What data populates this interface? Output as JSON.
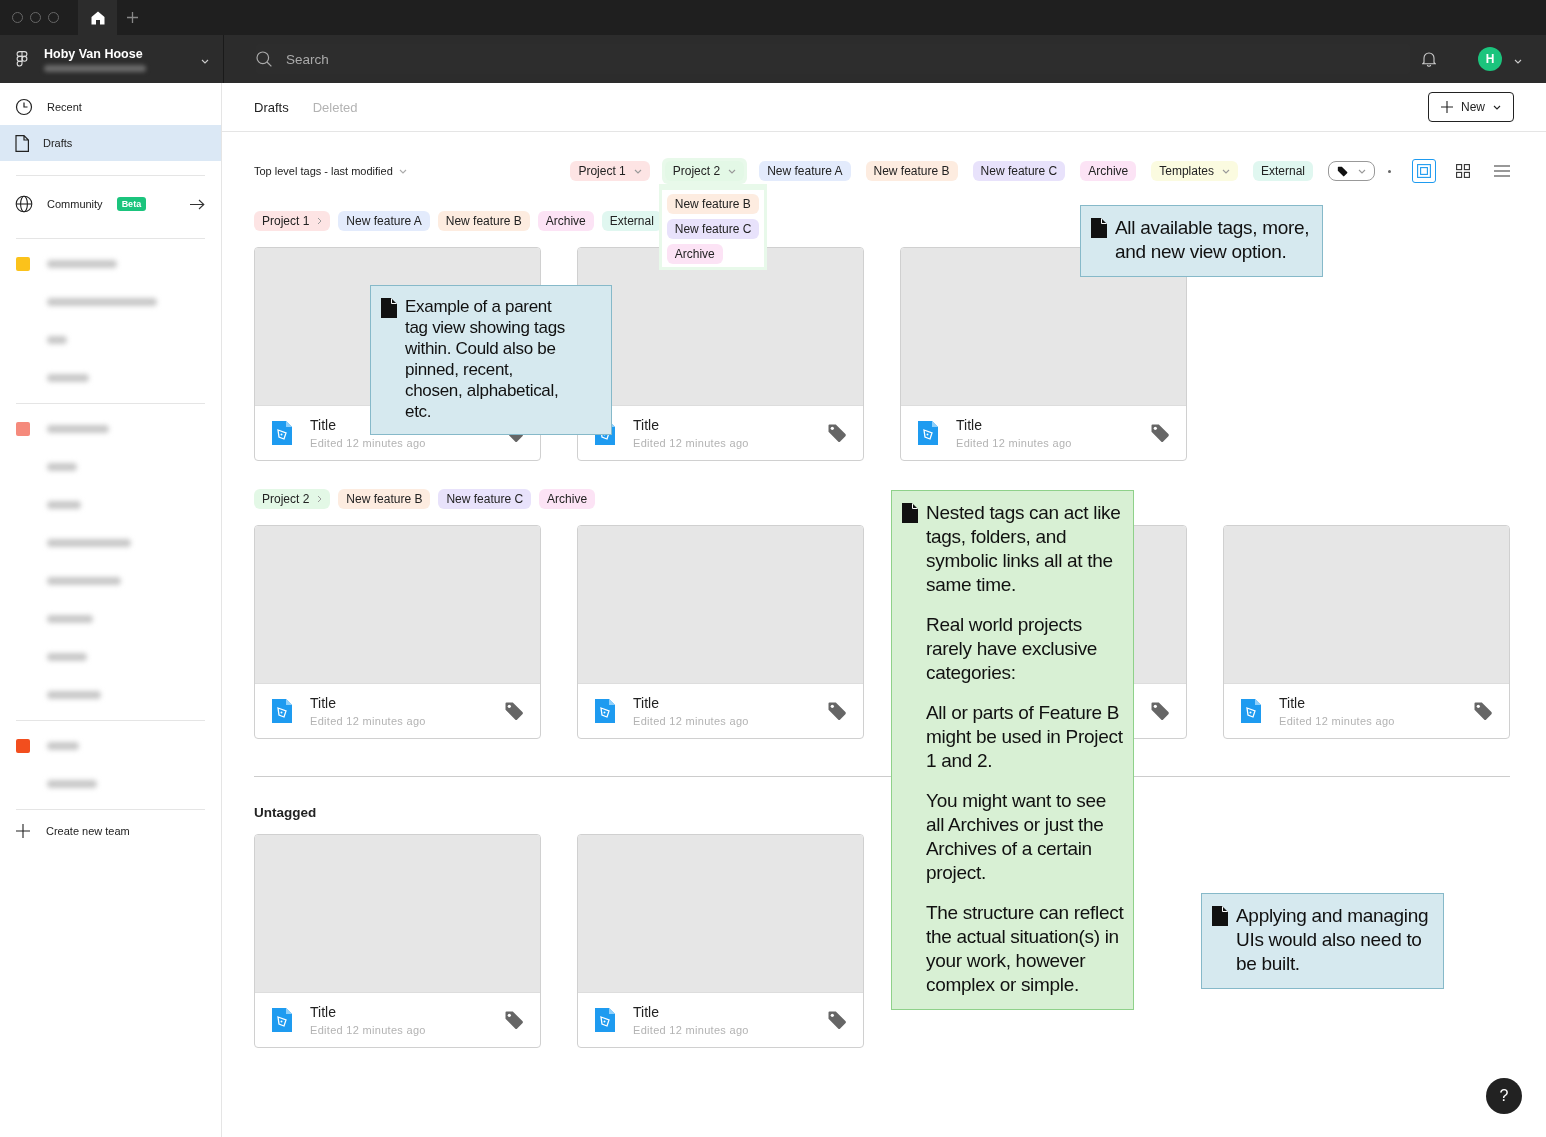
{
  "account": {
    "name": "Hoby Van Hoose",
    "email": {
      "kind": "blurred"
    }
  },
  "search": {
    "placeholder": "Search"
  },
  "avatar": {
    "initial": "H"
  },
  "sidebar": {
    "nav": [
      {
        "label": "Recent",
        "selected": false
      },
      {
        "label": "Drafts",
        "selected": true
      }
    ],
    "community": {
      "label": "Community",
      "badge": "Beta"
    },
    "teams": [
      {
        "color": "#fbc21b",
        "rows": [
          {
            "kind": "blurred"
          },
          {
            "kind": "blurred"
          },
          {
            "kind": "blurred"
          },
          {
            "kind": "blurred"
          }
        ]
      },
      {
        "color": "#f58a7c",
        "rows": [
          {
            "kind": "blurred"
          },
          {
            "kind": "blurred"
          },
          {
            "kind": "blurred"
          },
          {
            "kind": "blurred"
          },
          {
            "kind": "blurred"
          },
          {
            "kind": "blurred"
          },
          {
            "kind": "blurred"
          },
          {
            "kind": "blurred"
          }
        ]
      },
      {
        "color": "#f24e1e",
        "rows": [
          {
            "kind": "blurred"
          },
          {
            "kind": "blurred"
          }
        ]
      }
    ],
    "create_team": "Create new team"
  },
  "tabs": [
    {
      "label": "Drafts",
      "selected": true
    },
    {
      "label": "Deleted",
      "selected": false
    }
  ],
  "new_button": {
    "label": "New"
  },
  "sort": {
    "label": "Top level tags - last modified"
  },
  "tag_bar": [
    {
      "label": "Project 1",
      "color": "#fde4e4",
      "kind": "parent",
      "expanded": false
    },
    {
      "label": "Project 2",
      "color": "#e3f8e6",
      "kind": "parent",
      "expanded": true,
      "children": [
        {
          "label": "New feature B",
          "color": "#fdece0"
        },
        {
          "label": "New feature C",
          "color": "#e8e2fb"
        },
        {
          "label": "Archive",
          "color": "#fce3f5"
        }
      ]
    },
    {
      "label": "New feature A",
      "color": "#e3ebfc",
      "kind": "plain"
    },
    {
      "label": "New feature B",
      "color": "#fdece0",
      "kind": "plain"
    },
    {
      "label": "New feature C",
      "color": "#e8e2fb",
      "kind": "plain"
    },
    {
      "label": "Archive",
      "color": "#fce3f5",
      "kind": "plain"
    },
    {
      "label": "Templates",
      "color": "#fbfbe0",
      "kind": "parent",
      "expanded": false
    },
    {
      "label": "External",
      "color": "#e0f7f0",
      "kind": "plain"
    }
  ],
  "view_modes": [
    {
      "kind": "compact",
      "selected": true
    },
    {
      "kind": "grid",
      "selected": false
    },
    {
      "kind": "list",
      "selected": false
    }
  ],
  "sections": [
    {
      "tags": [
        {
          "label": "Project 1",
          "color": "#fde4e4",
          "kind": "parent"
        },
        {
          "label": "New feature A",
          "color": "#e3ebfc",
          "kind": "plain"
        },
        {
          "label": "New feature B",
          "color": "#fdece0",
          "kind": "plain"
        },
        {
          "label": "Archive",
          "color": "#fce3f5",
          "kind": "plain"
        },
        {
          "label": "External",
          "color": "#e0f7f0",
          "kind": "plain"
        }
      ],
      "files": [
        {
          "kind": "file",
          "title": "Title",
          "subtitle": "Edited 12 minutes ago"
        },
        {
          "kind": "file",
          "title": "Title",
          "subtitle": "Edited 12 minutes ago"
        },
        {
          "kind": "file",
          "title": "Title",
          "subtitle": "Edited 12 minutes ago"
        }
      ]
    },
    {
      "tags": [
        {
          "label": "Project 2",
          "color": "#e3f8e6",
          "kind": "parent"
        },
        {
          "label": "New feature B",
          "color": "#fdece0",
          "kind": "plain"
        },
        {
          "label": "New feature C",
          "color": "#e8e2fb",
          "kind": "plain"
        },
        {
          "label": "Archive",
          "color": "#fce3f5",
          "kind": "plain"
        }
      ],
      "files": [
        {
          "kind": "file",
          "title": "Title",
          "subtitle": "Edited 12 minutes ago"
        },
        {
          "kind": "file",
          "title": "Title",
          "subtitle": "Edited 12 minutes ago"
        },
        {
          "kind": "file"
        },
        {
          "kind": "file",
          "title": "Title",
          "subtitle": "Edited 12 minutes ago"
        }
      ]
    },
    {
      "heading": "Untagged",
      "files": [
        {
          "kind": "file",
          "title": "Title",
          "subtitle": "Edited 12 minutes ago"
        },
        {
          "kind": "file",
          "title": "Title",
          "subtitle": "Edited 12 minutes ago"
        }
      ]
    }
  ],
  "notes": [
    {
      "color": "#d6e9ef",
      "paragraphs": [
        "Example of a parent tag view showing tags within. Could also be pinned, recent, chosen, alphabetical, etc."
      ]
    },
    {
      "color": "#d6e9ef",
      "paragraphs": [
        "All available tags, more, and new view option."
      ]
    },
    {
      "color": "#d8f0d4",
      "paragraphs": [
        "Nested tags can act like tags, folders, and symbolic links all at the same time.",
        "Real world projects rarely have exclusive categories:",
        "All or parts of Feature B might be used in Project 1 and 2.",
        "You might want to see all Archives or just the Archives of a certain project.",
        "The structure can reflect the actual situation(s) in your work, however complex or simple."
      ]
    },
    {
      "color": "#d6e9ef",
      "paragraphs": [
        "Applying and managing UIs would also need to be built."
      ]
    }
  ],
  "help": {
    "label": "?"
  }
}
